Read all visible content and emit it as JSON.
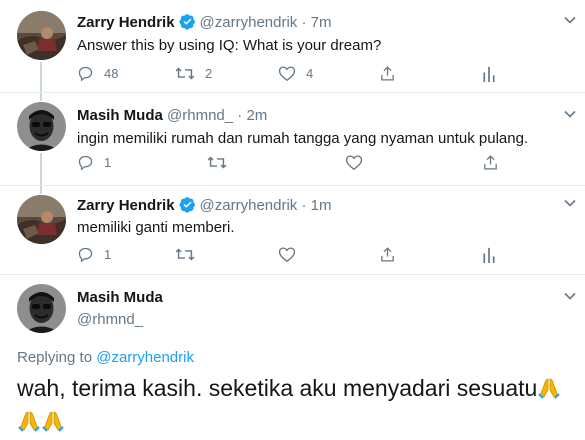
{
  "tweets": [
    {
      "name": "Zarry Hendrik",
      "handle": "@zarryhendrik",
      "separator": "·",
      "time": "7m",
      "text": "Answer this by using IQ: What is your dream?",
      "reply_count": "48",
      "retweet_count": "2",
      "like_count": "4"
    },
    {
      "name": "Masih Muda",
      "handle": "@rhmnd_",
      "separator": "·",
      "time": "2m",
      "text": "ingin memiliki rumah dan rumah tangga yang nyaman untuk pulang.",
      "reply_count": "1"
    },
    {
      "name": "Zarry Hendrik",
      "handle": "@zarryhendrik",
      "separator": "·",
      "time": "1m",
      "text": "memiliki ganti memberi.",
      "reply_count": "1"
    }
  ],
  "main_tweet": {
    "name": "Masih Muda",
    "handle": "@rhmnd_",
    "replying_prefix": "Replying to",
    "replying_mention": "@zarryhendrik",
    "text": "wah, terima kasih. seketika aku menyadari sesuatu"
  },
  "icons": {
    "reply": "reply-icon",
    "retweet": "retweet-icon",
    "like": "heart-icon",
    "share": "share-icon",
    "analytics": "analytics-icon",
    "caret": "chevron-down-icon",
    "verified": "verified-badge-icon",
    "emoji": "folded-hands-emoji"
  },
  "colors": {
    "accent": "#1da1f2",
    "text": "#14171a",
    "muted": "#657786",
    "line": "#ccd6dd"
  }
}
